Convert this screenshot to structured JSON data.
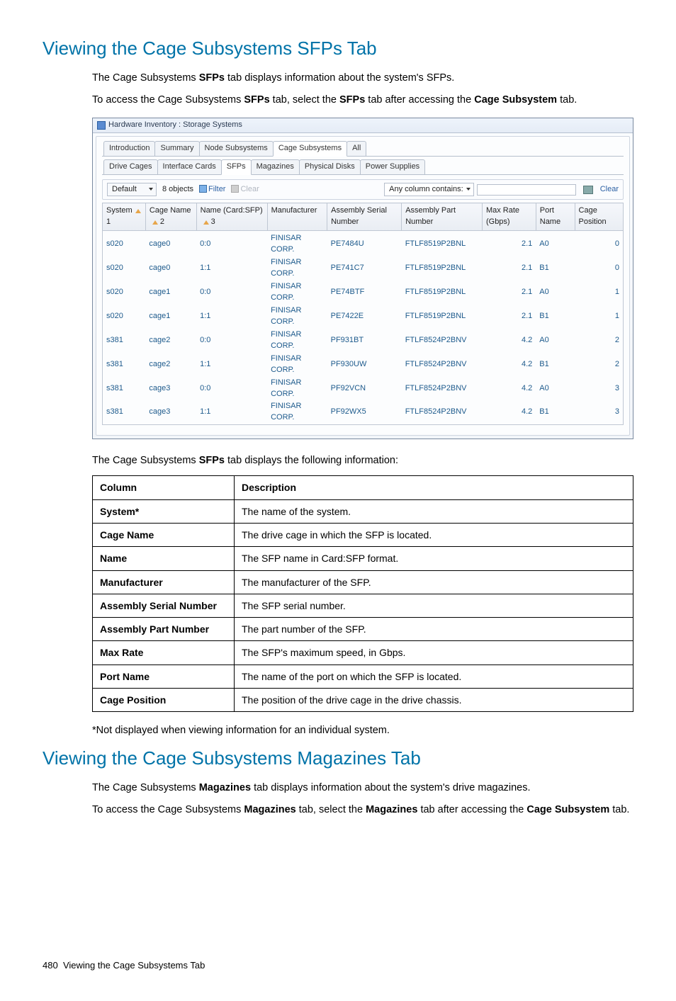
{
  "section1": {
    "heading": "Viewing the Cage Subsystems SFPs Tab",
    "intro_parts": [
      "The Cage Subsystems ",
      "SFPs",
      " tab displays information about the system's SFPs."
    ],
    "access_parts": [
      "To access the Cage Subsystems ",
      "SFPs",
      " tab, select the ",
      "SFPs",
      " tab after accessing the ",
      "Cage Subsystem",
      " tab."
    ],
    "displays_parts": [
      "The Cage Subsystems ",
      "SFPs",
      " tab displays the following information:"
    ],
    "footnote": "*Not displayed when viewing information for an individual system."
  },
  "screenshot": {
    "title": "Hardware Inventory : Storage Systems",
    "upper_tabs": [
      "Introduction",
      "Summary",
      "Node Subsystems",
      "Cage Subsystems",
      "All"
    ],
    "upper_active": "Cage Subsystems",
    "lower_tabs": [
      "Drive Cages",
      "Interface Cards",
      "SFPs",
      "Magazines",
      "Physical Disks",
      "Power Supplies"
    ],
    "lower_active": "SFPs",
    "filter": {
      "default": "Default",
      "objects": "8 objects",
      "filter_label": "Filter",
      "clear_filter": "Clear",
      "anycol_label": "Any column contains:",
      "clear_right": "Clear"
    },
    "columns": [
      {
        "label": "System",
        "sort": "1"
      },
      {
        "label": "Cage Name",
        "sort": "2"
      },
      {
        "label": "Name (Card:SFP)",
        "sort": "3"
      },
      {
        "label": "Manufacturer",
        "sort": ""
      },
      {
        "label": "Assembly Serial Number",
        "sort": ""
      },
      {
        "label": "Assembly Part Number",
        "sort": ""
      },
      {
        "label": "Max Rate (Gbps)",
        "sort": ""
      },
      {
        "label": "Port Name",
        "sort": ""
      },
      {
        "label": "Cage Position",
        "sort": ""
      }
    ],
    "rows": [
      {
        "system": "s020",
        "cage": "cage0",
        "name": "0:0",
        "mfr": "FINISAR CORP.",
        "asn": "PE7484U",
        "apn": "FTLF8519P2BNL",
        "rate": "2.1",
        "port": "A0",
        "pos": "0"
      },
      {
        "system": "s020",
        "cage": "cage0",
        "name": "1:1",
        "mfr": "FINISAR CORP.",
        "asn": "PE741C7",
        "apn": "FTLF8519P2BNL",
        "rate": "2.1",
        "port": "B1",
        "pos": "0"
      },
      {
        "system": "s020",
        "cage": "cage1",
        "name": "0:0",
        "mfr": "FINISAR CORP.",
        "asn": "PE74BTF",
        "apn": "FTLF8519P2BNL",
        "rate": "2.1",
        "port": "A0",
        "pos": "1"
      },
      {
        "system": "s020",
        "cage": "cage1",
        "name": "1:1",
        "mfr": "FINISAR CORP.",
        "asn": "PE7422E",
        "apn": "FTLF8519P2BNL",
        "rate": "2.1",
        "port": "B1",
        "pos": "1"
      },
      {
        "system": "s381",
        "cage": "cage2",
        "name": "0:0",
        "mfr": "FINISAR CORP.",
        "asn": "PF931BT",
        "apn": "FTLF8524P2BNV",
        "rate": "4.2",
        "port": "A0",
        "pos": "2"
      },
      {
        "system": "s381",
        "cage": "cage2",
        "name": "1:1",
        "mfr": "FINISAR CORP.",
        "asn": "PF930UW",
        "apn": "FTLF8524P2BNV",
        "rate": "4.2",
        "port": "B1",
        "pos": "2"
      },
      {
        "system": "s381",
        "cage": "cage3",
        "name": "0:0",
        "mfr": "FINISAR CORP.",
        "asn": "PF92VCN",
        "apn": "FTLF8524P2BNV",
        "rate": "4.2",
        "port": "A0",
        "pos": "3"
      },
      {
        "system": "s381",
        "cage": "cage3",
        "name": "1:1",
        "mfr": "FINISAR CORP.",
        "asn": "PF92WX5",
        "apn": "FTLF8524P2BNV",
        "rate": "4.2",
        "port": "B1",
        "pos": "3"
      }
    ]
  },
  "desc_table": {
    "headers": [
      "Column",
      "Description"
    ],
    "rows": [
      [
        "System*",
        "The name of the system."
      ],
      [
        "Cage Name",
        "The drive cage in which the SFP is located."
      ],
      [
        "Name",
        "The SFP name in Card:SFP format."
      ],
      [
        "Manufacturer",
        "The manufacturer of the SFP."
      ],
      [
        "Assembly Serial Number",
        "The SFP serial number."
      ],
      [
        "Assembly Part Number",
        "The part number of the SFP."
      ],
      [
        "Max Rate",
        "The SFP's maximum speed, in Gbps."
      ],
      [
        "Port Name",
        "The name of the port on which the SFP is located."
      ],
      [
        "Cage Position",
        "The position of the drive cage in the drive chassis."
      ]
    ]
  },
  "section2": {
    "heading": "Viewing the Cage Subsystems Magazines Tab",
    "intro_parts": [
      "The Cage Subsystems ",
      "Magazines",
      " tab displays information about the system's drive magazines."
    ],
    "access_parts": [
      "To access the Cage Subsystems ",
      "Magazines",
      " tab, select the ",
      "Magazines",
      " tab after accessing the ",
      "Cage Subsystem",
      " tab."
    ]
  },
  "footer": {
    "page_number": "480",
    "chapter": "Viewing the Cage Subsystems Tab"
  }
}
